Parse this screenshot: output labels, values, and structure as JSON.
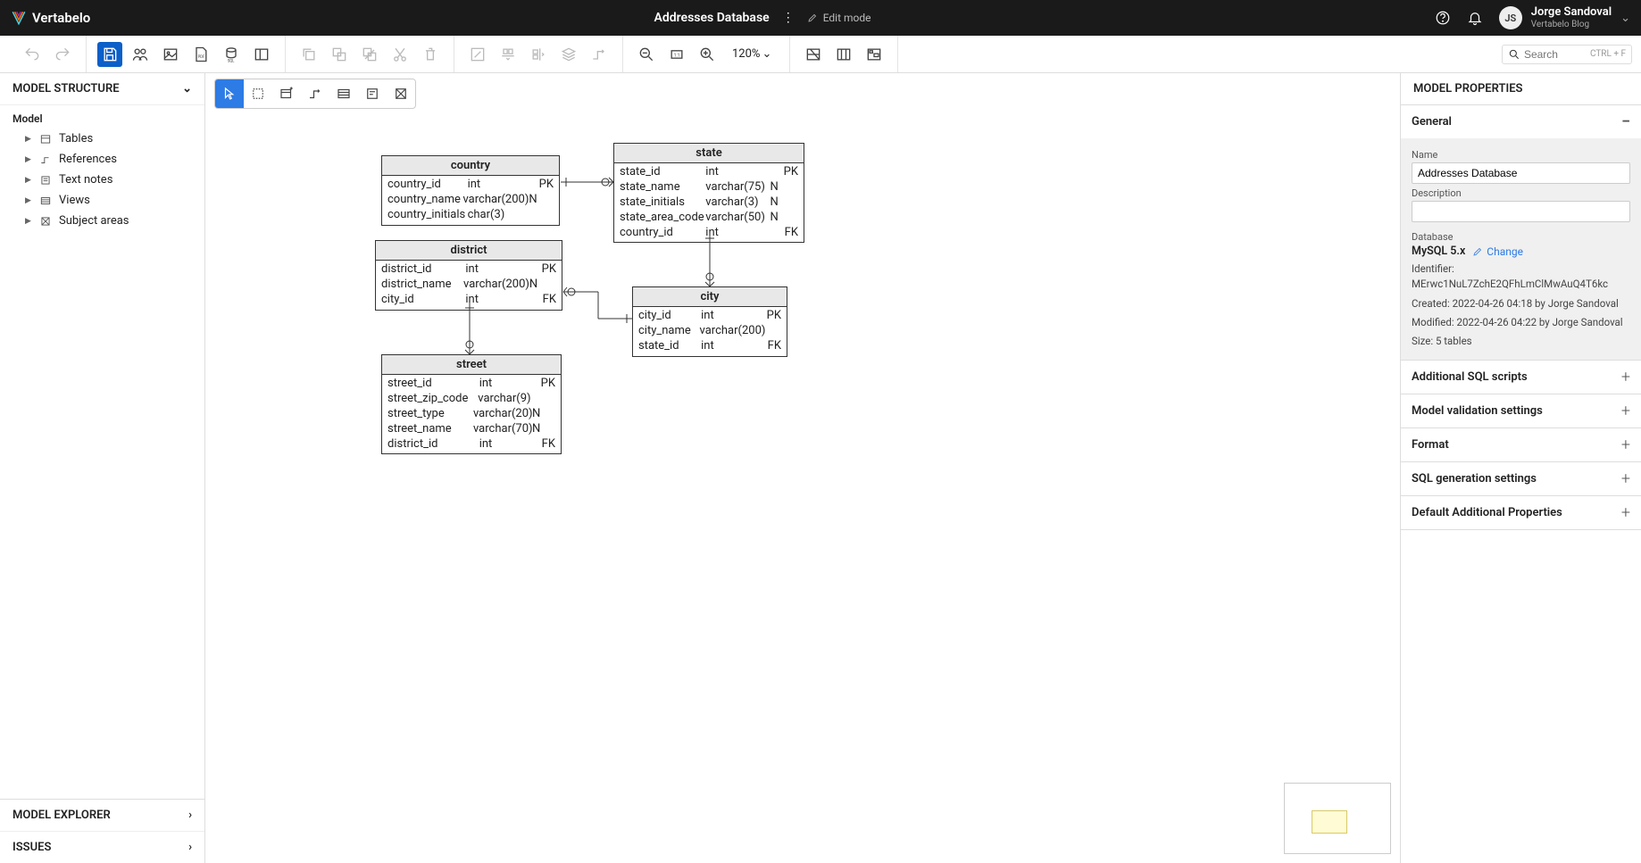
{
  "brand": "Vertabelo",
  "document_title": "Addresses Database",
  "edit_mode": "Edit mode",
  "user": {
    "initials": "JS",
    "name": "Jorge Sandoval",
    "sub": "Vertabelo Blog"
  },
  "zoom": "120%",
  "search_placeholder": "Search",
  "search_hint": "CTRL + F",
  "left_panel": {
    "structure_title": "MODEL STRUCTURE",
    "model_label": "Model",
    "tree": [
      {
        "label": "Tables"
      },
      {
        "label": "References"
      },
      {
        "label": "Text notes"
      },
      {
        "label": "Views"
      },
      {
        "label": "Subject areas"
      }
    ],
    "explorer_title": "MODEL EXPLORER",
    "issues_title": "ISSUES"
  },
  "right_panel": {
    "title": "MODEL PROPERTIES",
    "general_label": "General",
    "name_label": "Name",
    "name_value": "Addresses Database",
    "description_label": "Description",
    "description_value": "",
    "database_label": "Database",
    "database_value": "MySQL 5.x",
    "change_label": "Change",
    "identifier": "Identifier: MErwc1NuL7ZchE2QFhLmClMwAuQ4T6kc",
    "created": "Created: 2022-04-26 04:18 by Jorge Sandoval",
    "modified": "Modified: 2022-04-26 04:22 by Jorge Sandoval",
    "size": "Size: 5 tables",
    "sections": [
      "Additional SQL scripts",
      "Model validation settings",
      "Format",
      "SQL generation settings",
      "Default Additional Properties"
    ]
  },
  "entities": {
    "country": {
      "title": "country",
      "attrs": [
        {
          "name": "country_id",
          "type": "int",
          "null": "",
          "key": "PK"
        },
        {
          "name": "country_name",
          "type": "varchar(200)",
          "null": "N",
          "key": ""
        },
        {
          "name": "country_initials",
          "type": "char(3)",
          "null": "",
          "key": ""
        }
      ]
    },
    "state": {
      "title": "state",
      "attrs": [
        {
          "name": "state_id",
          "type": "int",
          "null": "",
          "key": "PK"
        },
        {
          "name": "state_name",
          "type": "varchar(75)",
          "null": "N",
          "key": ""
        },
        {
          "name": "state_initials",
          "type": "varchar(3)",
          "null": "N",
          "key": ""
        },
        {
          "name": "state_area_code",
          "type": "varchar(50)",
          "null": "N",
          "key": ""
        },
        {
          "name": "country_id",
          "type": "int",
          "null": "",
          "key": "FK"
        }
      ]
    },
    "district": {
      "title": "district",
      "attrs": [
        {
          "name": "district_id",
          "type": "int",
          "null": "",
          "key": "PK"
        },
        {
          "name": "district_name",
          "type": "varchar(200)",
          "null": "N",
          "key": ""
        },
        {
          "name": "city_id",
          "type": "int",
          "null": "",
          "key": "FK"
        }
      ]
    },
    "city": {
      "title": "city",
      "attrs": [
        {
          "name": "city_id",
          "type": "int",
          "null": "",
          "key": "PK"
        },
        {
          "name": "city_name",
          "type": "varchar(200)",
          "null": "",
          "key": ""
        },
        {
          "name": "state_id",
          "type": "int",
          "null": "",
          "key": "FK"
        }
      ]
    },
    "street": {
      "title": "street",
      "attrs": [
        {
          "name": "street_id",
          "type": "int",
          "null": "",
          "key": "PK"
        },
        {
          "name": "street_zip_code",
          "type": "varchar(9)",
          "null": "",
          "key": ""
        },
        {
          "name": "street_type",
          "type": "varchar(20)",
          "null": "N",
          "key": ""
        },
        {
          "name": "street_name",
          "type": "varchar(70)",
          "null": "N",
          "key": ""
        },
        {
          "name": "district_id",
          "type": "int",
          "null": "",
          "key": "FK"
        }
      ]
    }
  }
}
